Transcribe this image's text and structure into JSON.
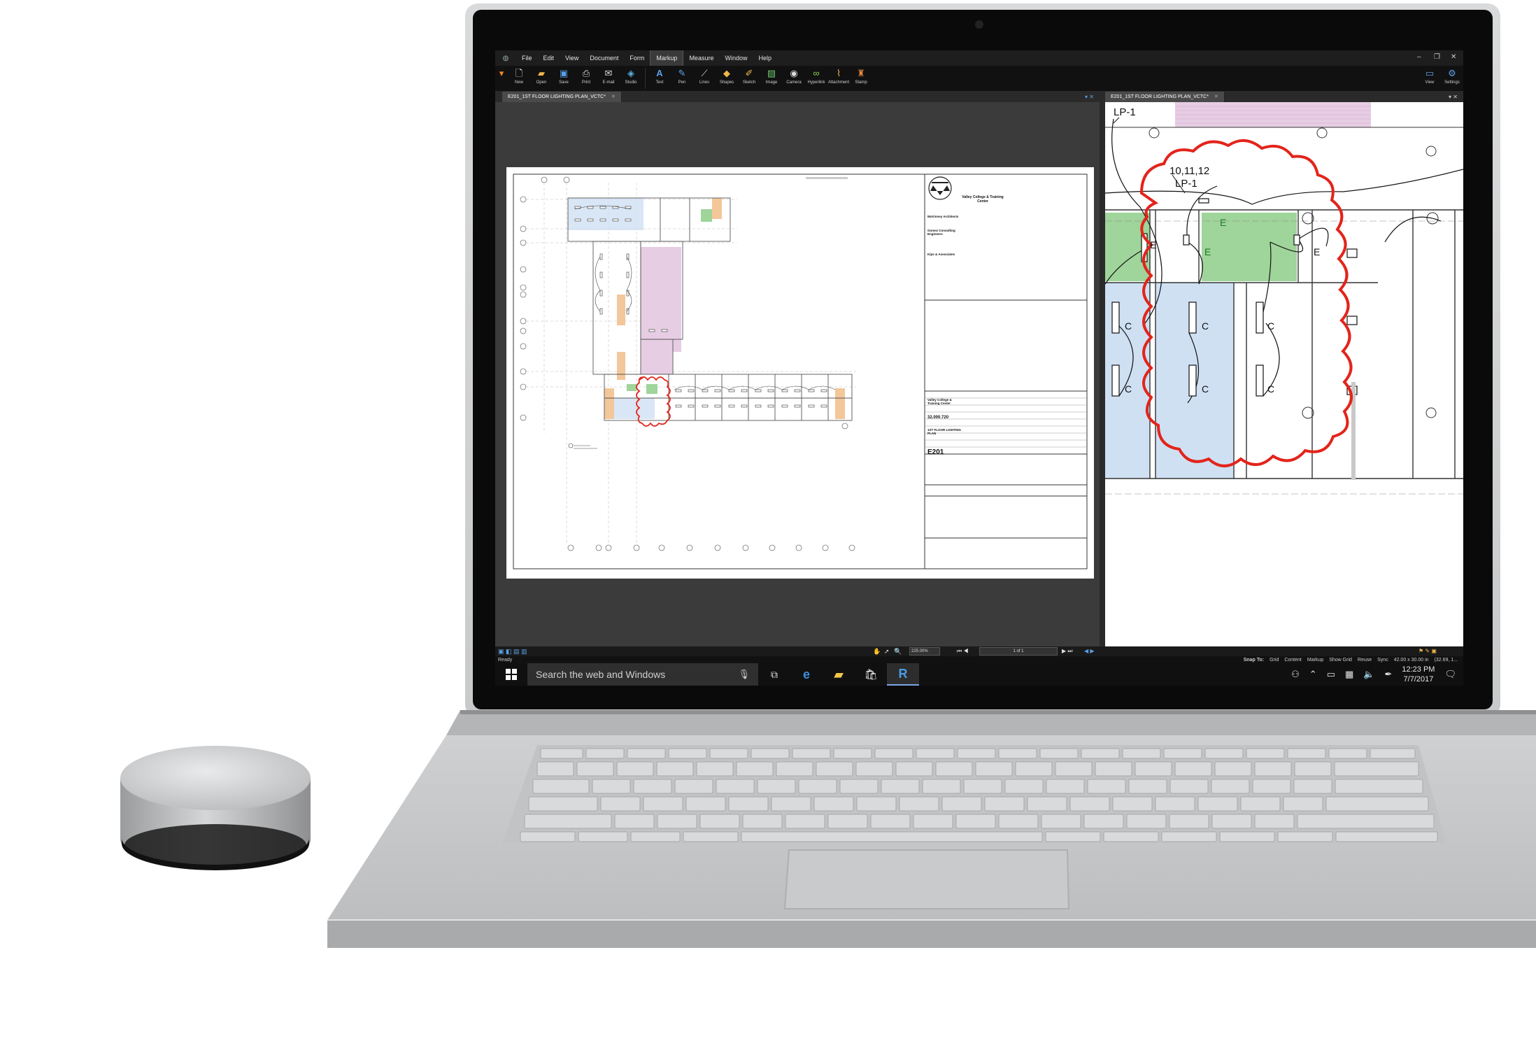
{
  "app": {
    "menu": [
      "File",
      "Edit",
      "View",
      "Document",
      "Form",
      "Markup",
      "Measure",
      "Window",
      "Help"
    ],
    "active_menu": "Markup",
    "toolbar_left": [
      "New",
      "Open",
      "Save",
      "Print",
      "E-mail",
      "Studio"
    ],
    "toolbar_markup": [
      "Text",
      "Pen",
      "Lines",
      "Shapes",
      "Sketch",
      "Image",
      "Camera",
      "Hyperlink",
      "Attachment",
      "Stamp"
    ],
    "toolbar_right": [
      "View",
      "Settings"
    ],
    "tab_left": "E201_1ST FLOOR LIGHTING PLAN_VCTC*",
    "tab_right": "E201_1ST FLOOR LIGHTING PLAN_VCTC*",
    "zoom": "225.00%",
    "page_indicator": "1 of 1",
    "status": "Ready",
    "status_right": [
      "Snap To:",
      "Grid",
      "Content",
      "Markup",
      "Show Grid",
      "Reuse",
      "Sync",
      "42.00 x 30.00 in",
      "(32.69, 1..."
    ]
  },
  "titleblock": {
    "project": "Valley College & Training Center",
    "firm1": "McKinney Architects",
    "firm2": "Gomez Consulting Engineers",
    "firm3": "Kips & Associates",
    "project_repeat": "Valley College & Training Center",
    "number": "32.000.720",
    "sheet_title": "1ST FLOOR LIGHTING PLAN",
    "sheet_number": "E201"
  },
  "detail": {
    "panel_top": "LP-1",
    "circuit": "10,11,12",
    "panel": "LP-1",
    "fixture_e": "E",
    "fixture_c": "C"
  },
  "taskbar": {
    "search_placeholder": "Search the web and Windows",
    "time": "12:23 PM",
    "date": "7/7/2017"
  },
  "colors": {
    "markup_cloud": "#e3241b",
    "room_green": "#9fd49a",
    "room_blue": "#cfe0f3",
    "room_pink": "#e7cde4",
    "room_orange": "#f3c79a"
  }
}
